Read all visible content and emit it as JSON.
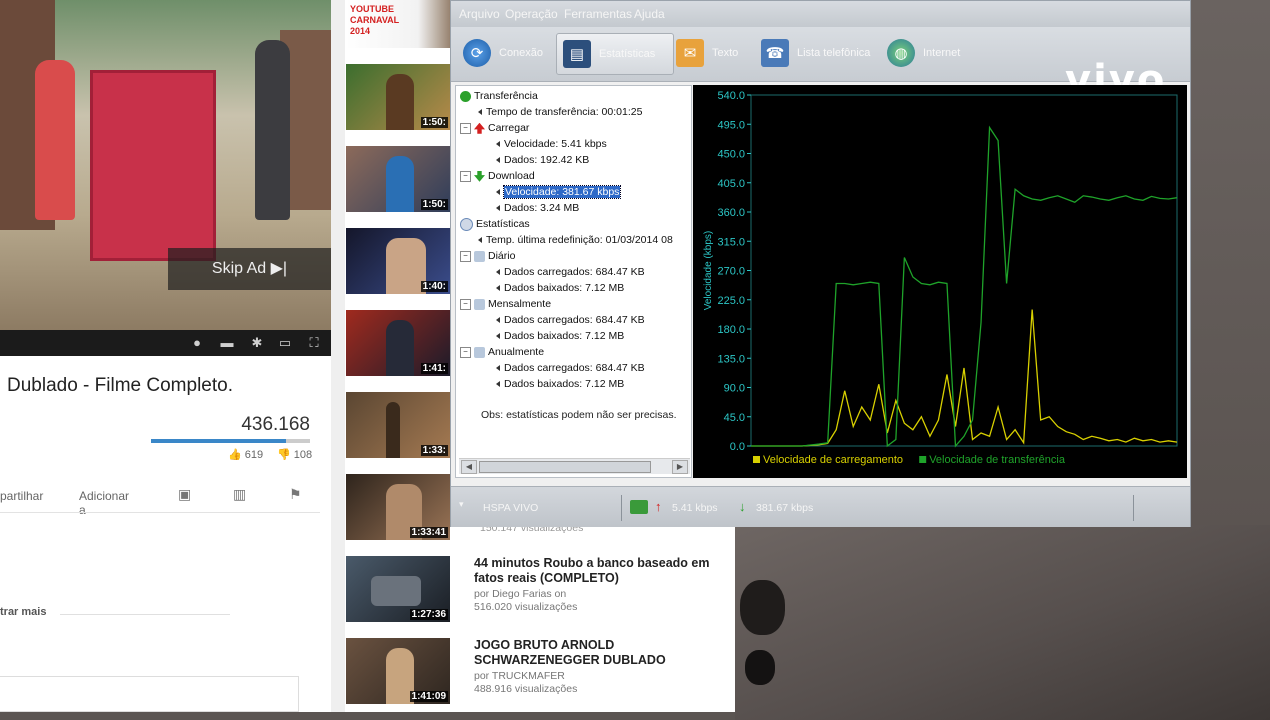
{
  "youtube": {
    "skip_ad": "Skip Ad ▶|",
    "video_title": "Dublado - Filme Completo.",
    "views": "436.168",
    "views_ratio": 0.85,
    "likes": "619",
    "dislikes": "108",
    "share_label": "partilhar",
    "add_label": "Adicionar a",
    "show_more": "trar mais",
    "partial_views": "150.147 visualizações",
    "thumb_durations": [
      "1:50:",
      "1:50:",
      "1:40:",
      "1:41:",
      "1:33:",
      "1:33:41"
    ],
    "related": [
      {
        "title": "44 minutos Roubo a banco baseado em fatos reais (COMPLETO)",
        "by": "por Diego Farias on",
        "views": "516.020 visualizações",
        "duration": "1:27:36"
      },
      {
        "title": "JOGO BRUTO ARNOLD SCHWARZENEGGER DUBLADO",
        "by": "por TRUCKMAFER",
        "views": "488.916 visualizações",
        "duration": "1:41:09"
      }
    ],
    "top_thumb_text": "YOUTUBE CARNAVAL 2014"
  },
  "app": {
    "menu": [
      "Arquivo",
      "Operação",
      "Ferramentas",
      "Ajuda"
    ],
    "toolbar": [
      {
        "label": "Conexão",
        "icon": "refresh-icon"
      },
      {
        "label": "Estatísticas",
        "icon": "monitor-icon"
      },
      {
        "label": "Texto",
        "icon": "envelope-icon"
      },
      {
        "label": "Lista telefônica",
        "icon": "phonebook-icon"
      },
      {
        "label": "Internet",
        "icon": "globe-icon"
      }
    ],
    "logo": "vivo",
    "tree": {
      "transfer": "Transferência",
      "transfer_time": "Tempo de transferência: 00:01:25",
      "upload": "Carregar",
      "upload_speed": "Velocidade: 5.41 kbps",
      "upload_data": "Dados: 192.42 KB",
      "download": "Download",
      "download_speed": "Velocidade: 381.67 kbps",
      "download_data": "Dados: 3.24 MB",
      "stats": "Estatísticas",
      "last_reset": "Temp. última redefinição: 01/03/2014 08",
      "daily": "Diário",
      "daily_up": "Dados carregados: 684.47 KB",
      "daily_down": "Dados baixados: 7.12 MB",
      "monthly": "Mensalmente",
      "monthly_up": "Dados carregados: 684.47 KB",
      "monthly_down": "Dados baixados: 7.12 MB",
      "yearly": "Anualmente",
      "yearly_up": "Dados carregados: 684.47 KB",
      "yearly_down": "Dados baixados: 7.12 MB",
      "note": "Obs: estatísticas podem não ser precisas."
    },
    "status": {
      "network": "HSPA  VIVO",
      "up": "5.41 kbps",
      "down": "381.67 kbps"
    },
    "colors": {
      "upload": "#d8d000",
      "transfer": "#1fa32a",
      "axis": "#2cc6c6"
    }
  },
  "chart_data": {
    "type": "line",
    "ylabel": "Velocidade (kbps)",
    "ylim": [
      0,
      540
    ],
    "yticks": [
      "540.0",
      "495.0",
      "450.0",
      "405.0",
      "360.0",
      "315.0",
      "270.0",
      "225.0",
      "180.0",
      "135.0",
      "90.0",
      "45.0",
      "0.0"
    ],
    "x": [
      0,
      4,
      8,
      12,
      16,
      18,
      20,
      22,
      24,
      26,
      28,
      30,
      32,
      34,
      36,
      38,
      40,
      42,
      44,
      46,
      48,
      50,
      52,
      54,
      56,
      58,
      60,
      62,
      64,
      66,
      68,
      70,
      72,
      74,
      76,
      78,
      80,
      82,
      84,
      86,
      88,
      90,
      92,
      94,
      96,
      98,
      100
    ],
    "series": [
      {
        "name": "Velocidade de carregamento",
        "color": "#d8d000",
        "values": [
          0,
          0,
          0,
          0,
          2,
          4,
          25,
          85,
          30,
          60,
          40,
          95,
          20,
          70,
          35,
          25,
          45,
          15,
          40,
          110,
          30,
          120,
          10,
          20,
          15,
          60,
          10,
          25,
          5,
          210,
          40,
          45,
          30,
          22,
          18,
          10,
          15,
          12,
          8,
          10,
          6,
          12,
          8,
          10,
          6,
          8,
          6
        ]
      },
      {
        "name": "Velocidade de transferência",
        "color": "#1fa32a",
        "values": [
          0,
          0,
          0,
          0,
          3,
          5,
          250,
          250,
          248,
          250,
          252,
          250,
          0,
          10,
          290,
          260,
          250,
          248,
          252,
          250,
          0,
          15,
          40,
          190,
          490,
          470,
          250,
          395,
          385,
          380,
          378,
          382,
          385,
          380,
          375,
          385,
          383,
          380,
          378,
          382,
          385,
          380,
          378,
          384,
          381,
          380,
          382
        ]
      }
    ]
  }
}
